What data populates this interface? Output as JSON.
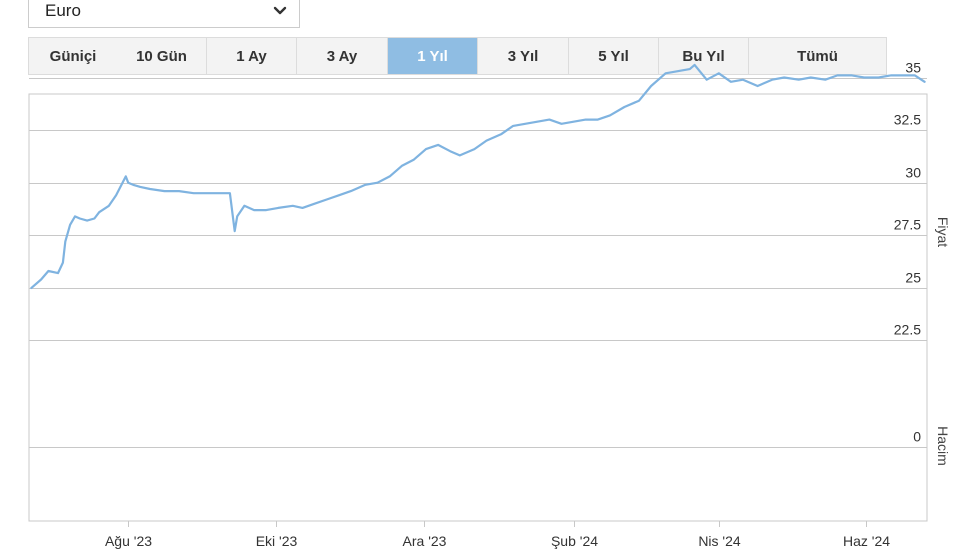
{
  "currency_select": {
    "value": "Euro",
    "icon": "chevron-down-icon"
  },
  "range_tabs": [
    {
      "label": "Güniçi",
      "active": false
    },
    {
      "label": "10 Gün",
      "active": false
    },
    {
      "label": "1 Ay",
      "active": false
    },
    {
      "label": "3 Ay",
      "active": false
    },
    {
      "label": "1 Yıl",
      "active": true
    },
    {
      "label": "3 Yıl",
      "active": false
    },
    {
      "label": "5 Yıl",
      "active": false
    },
    {
      "label": "Bu Yıl",
      "active": false
    },
    {
      "label": "Tümü",
      "active": false
    }
  ],
  "colors": {
    "line": "#7fb3e0",
    "active_tab": "#8fbde3",
    "grid": "#c8c8c8"
  },
  "chart_data": {
    "type": "line",
    "title": "",
    "grid": true,
    "price_panel": {
      "ylabel": "Fiyat",
      "ylim": [
        21,
        36.5
      ],
      "yticks": [
        22.5,
        25,
        27.5,
        30,
        32.5,
        35
      ],
      "ytick_labels": [
        "22.5",
        "25",
        "27.5",
        "30",
        "32.5",
        "35"
      ]
    },
    "volume_panel": {
      "ylabel": "Hacim",
      "yticks": [
        0
      ],
      "ytick_labels": [
        "0"
      ]
    },
    "xlim": [
      "2023-06-21",
      "2024-06-26"
    ],
    "xticks": [
      "2023-08-01",
      "2023-10-01",
      "2023-12-01",
      "2024-02-01",
      "2024-04-01",
      "2024-06-01"
    ],
    "xtick_labels": [
      "Ağu '23",
      "Eki '23",
      "Ara '23",
      "Şub '24",
      "Nis '24",
      "Haz '24"
    ],
    "series": [
      {
        "x": [
          "2023-06-22",
          "2023-06-26",
          "2023-06-29",
          "2023-07-03",
          "2023-07-05",
          "2023-07-06",
          "2023-07-08",
          "2023-07-10",
          "2023-07-12",
          "2023-07-15",
          "2023-07-18",
          "2023-07-20",
          "2023-07-24",
          "2023-07-27",
          "2023-07-31",
          "2023-08-01",
          "2023-08-03",
          "2023-08-06",
          "2023-08-10",
          "2023-08-16",
          "2023-08-22",
          "2023-08-28",
          "2023-09-02",
          "2023-09-07",
          "2023-09-12",
          "2023-09-14",
          "2023-09-15",
          "2023-09-18",
          "2023-09-22",
          "2023-09-27",
          "2023-10-02",
          "2023-10-08",
          "2023-10-12",
          "2023-10-17",
          "2023-10-22",
          "2023-10-27",
          "2023-11-01",
          "2023-11-07",
          "2023-11-12",
          "2023-11-17",
          "2023-11-22",
          "2023-11-27",
          "2023-12-02",
          "2023-12-07",
          "2023-12-12",
          "2023-12-16",
          "2023-12-22",
          "2023-12-27",
          "2024-01-02",
          "2024-01-07",
          "2024-01-12",
          "2024-01-17",
          "2024-01-22",
          "2024-01-27",
          "2024-02-01",
          "2024-02-06",
          "2024-02-11",
          "2024-02-16",
          "2024-02-22",
          "2024-02-28",
          "2024-03-04",
          "2024-03-10",
          "2024-03-15",
          "2024-03-20",
          "2024-03-22",
          "2024-03-27",
          "2024-04-01",
          "2024-04-06",
          "2024-04-11",
          "2024-04-17",
          "2024-04-23",
          "2024-04-28",
          "2024-05-04",
          "2024-05-09",
          "2024-05-15",
          "2024-05-20",
          "2024-05-26",
          "2024-05-31",
          "2024-06-06",
          "2024-06-11",
          "2024-06-16",
          "2024-06-21",
          "2024-06-25"
        ],
        "values": [
          25.0,
          25.4,
          25.8,
          25.7,
          26.2,
          27.2,
          28.0,
          28.4,
          28.3,
          28.2,
          28.3,
          28.6,
          28.9,
          29.4,
          30.3,
          30.0,
          29.9,
          29.8,
          29.7,
          29.6,
          29.6,
          29.5,
          29.5,
          29.5,
          29.5,
          27.7,
          28.4,
          28.9,
          28.7,
          28.7,
          28.8,
          28.9,
          28.8,
          29.0,
          29.2,
          29.4,
          29.6,
          29.9,
          30.0,
          30.3,
          30.8,
          31.1,
          31.6,
          31.8,
          31.5,
          31.3,
          31.6,
          32.0,
          32.3,
          32.7,
          32.8,
          32.9,
          33.0,
          32.8,
          32.9,
          33.0,
          33.0,
          33.2,
          33.6,
          33.9,
          34.6,
          35.2,
          35.3,
          35.4,
          35.6,
          34.9,
          35.2,
          34.8,
          34.9,
          34.6,
          34.9,
          35.0,
          34.9,
          35.0,
          34.9,
          35.1,
          35.1,
          35.0,
          35.0,
          35.1,
          35.1,
          35.1,
          34.8
        ]
      }
    ]
  }
}
